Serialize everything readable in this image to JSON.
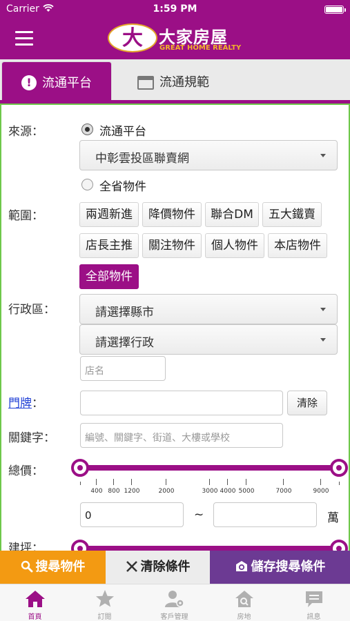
{
  "status_bar": {
    "carrier": "Carrier",
    "time": "1:59 PM"
  },
  "header": {
    "logo_char": "大",
    "logo_cn": "大家房屋",
    "logo_en": "GREAT HOME REALTY"
  },
  "tabs": [
    {
      "label": "流通平台",
      "icon": "exclamation-circle-icon",
      "active": true
    },
    {
      "label": "流通規範",
      "icon": "window-icon",
      "active": false
    }
  ],
  "form": {
    "source": {
      "label": "來源：",
      "radio_platform": "流通平台",
      "platform_select": "中彰雲投區聯賣網",
      "radio_all": "全省物件"
    },
    "scope": {
      "label": "範圍：",
      "chips": [
        "兩週新進",
        "降價物件",
        "聯合DM",
        "五大鐵賣",
        "店長主推",
        "關注物件",
        "個人物件",
        "本店物件",
        "全部物件"
      ]
    },
    "district": {
      "label": "行政區：",
      "county_select": "請選擇縣市",
      "district_select": "請選擇行政",
      "store_placeholder": "店名"
    },
    "house_number": {
      "label": "門牌",
      "colon": "：",
      "clear_button": "清除"
    },
    "keyword": {
      "label": "關鍵字：",
      "placeholder": "編號、關鍵字、街道、大樓或學校"
    },
    "price": {
      "label": "總價：",
      "ticks": [
        "400",
        "800",
        "1200",
        "2000",
        "3000",
        "4000",
        "5000",
        "7000",
        "9000"
      ],
      "min_value": "0",
      "separator": "~",
      "max_value": "",
      "unit": "萬"
    },
    "area": {
      "label": "建坪："
    }
  },
  "actions": {
    "search": "搜尋物件",
    "clear": "清除條件",
    "save": "儲存搜尋條件"
  },
  "tabbar": [
    {
      "label": "首頁",
      "icon": "home-icon",
      "active": true
    },
    {
      "label": "訂閱",
      "icon": "star-icon",
      "active": false
    },
    {
      "label": "客戶管理",
      "icon": "customer-settings-icon",
      "active": false
    },
    {
      "label": "房地",
      "icon": "house-search-icon",
      "active": false
    },
    {
      "label": "訊息",
      "icon": "message-icon",
      "active": false
    }
  ],
  "colors": {
    "brand": "#9b0f86",
    "search": "#f39a12",
    "save": "#6c3a93",
    "border_green": "#6ec84a"
  }
}
